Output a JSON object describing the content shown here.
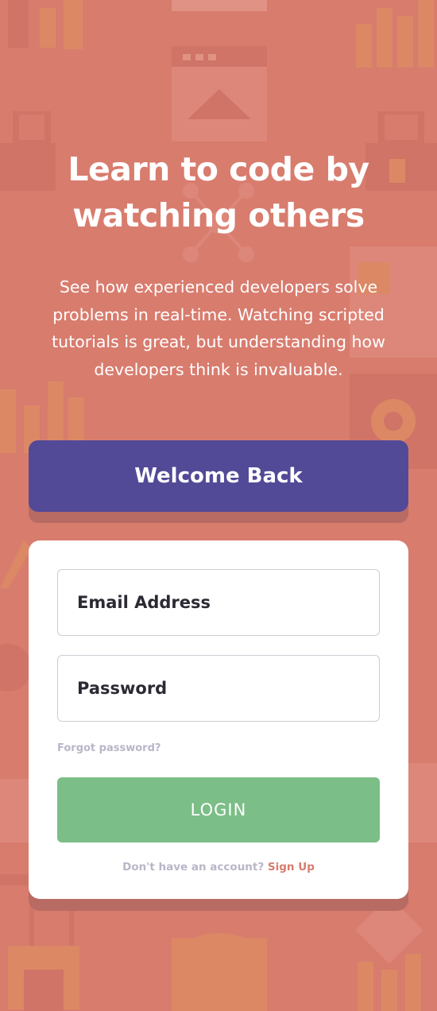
{
  "hero": {
    "headline": "Learn to code by watching others",
    "description": "See how experienced developers solve problems in real-time. Watching scripted tutorials is great, but understanding how developers think is invaluable."
  },
  "welcome": {
    "label": "Welcome Back"
  },
  "form": {
    "email_placeholder": "Email Address",
    "password_placeholder": "Password",
    "forgot_label": "Forgot password?",
    "login_label": "LOGIN",
    "no_account_text": "Don't have an account?",
    "signup_label": "Sign Up"
  },
  "colors": {
    "background": "#d87c6e",
    "welcome_banner": "#534a97",
    "login_button": "#7bbe87",
    "signup_link": "#d87c6e",
    "muted_text": "#b9b6c8"
  },
  "icons": [
    "bar-chart-icon",
    "browser-window-icon",
    "home-icon",
    "network-icon",
    "gear-icon",
    "toolbox-icon",
    "pencil-icon"
  ]
}
